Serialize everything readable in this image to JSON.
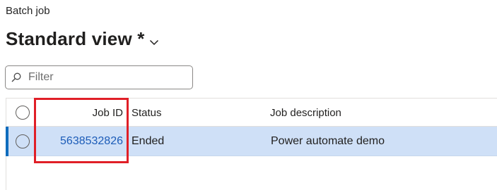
{
  "breadcrumb": "Batch job",
  "view": {
    "title": "Standard view *"
  },
  "filter": {
    "placeholder": "Filter",
    "value": ""
  },
  "grid": {
    "columns": {
      "job_id": "Job ID",
      "status": "Status",
      "description": "Job description"
    },
    "rows": [
      {
        "job_id": "5638532826",
        "status": "Ended",
        "description": "Power automate demo",
        "selected": true
      }
    ]
  },
  "colors": {
    "accent": "#0f6cbd",
    "selected_row": "#cfe0f7",
    "link": "#1c5cb8",
    "highlight": "#e01f27"
  },
  "icons": {
    "filter": "search-icon",
    "view_menu": "chevron-down-icon"
  }
}
